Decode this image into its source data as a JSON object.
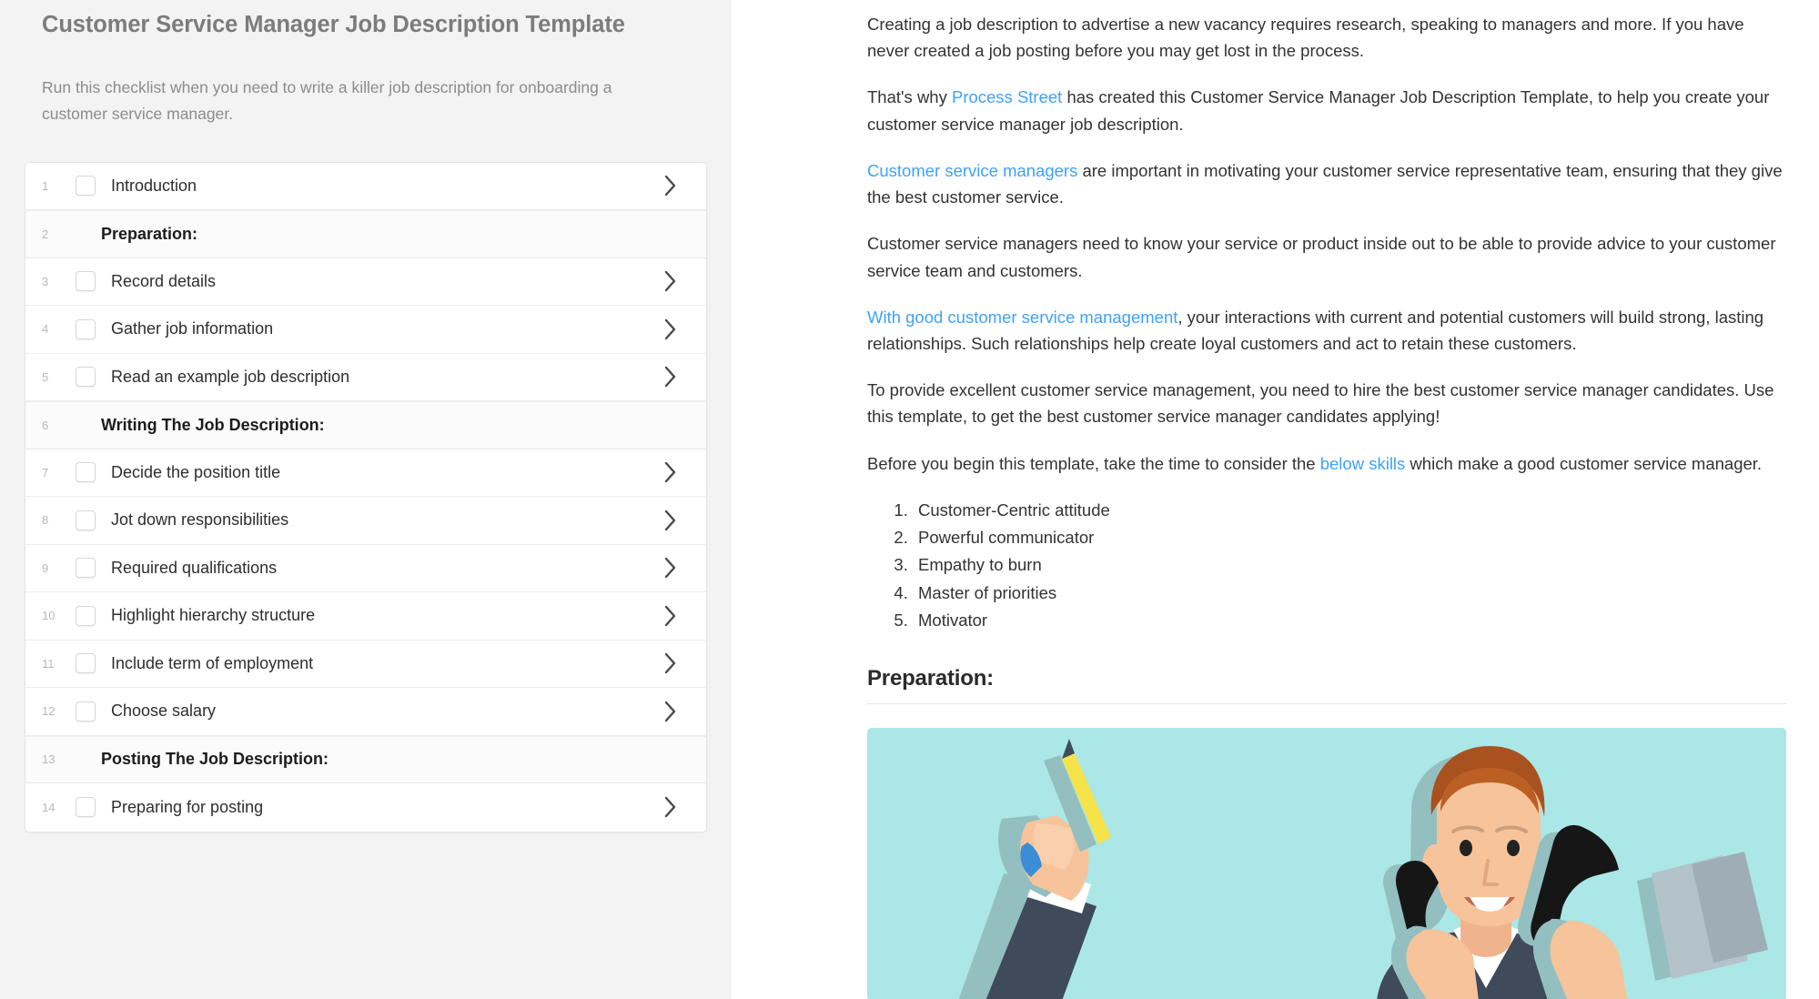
{
  "checklist": {
    "title": "Customer Service Manager Job Description Template",
    "description": "Run this checklist when you need to write a killer job description for onboarding a customer service manager.",
    "items": [
      {
        "num": "1",
        "label": "Introduction",
        "type": "task"
      },
      {
        "num": "2",
        "label": "Preparation:",
        "type": "heading"
      },
      {
        "num": "3",
        "label": "Record details",
        "type": "task"
      },
      {
        "num": "4",
        "label": "Gather job information",
        "type": "task"
      },
      {
        "num": "5",
        "label": "Read an example job description",
        "type": "task"
      },
      {
        "num": "6",
        "label": "Writing The Job Description:",
        "type": "heading"
      },
      {
        "num": "7",
        "label": "Decide the position title",
        "type": "task"
      },
      {
        "num": "8",
        "label": "Jot down responsibilities",
        "type": "task"
      },
      {
        "num": "9",
        "label": "Required qualifications",
        "type": "task"
      },
      {
        "num": "10",
        "label": "Highlight hierarchy structure",
        "type": "task"
      },
      {
        "num": "11",
        "label": "Include term of employment",
        "type": "task"
      },
      {
        "num": "12",
        "label": "Choose salary",
        "type": "task"
      },
      {
        "num": "13",
        "label": "Posting The Job Description:",
        "type": "heading"
      },
      {
        "num": "14",
        "label": "Preparing for posting",
        "type": "task"
      }
    ]
  },
  "document": {
    "paragraphs": {
      "p1": "Creating a job description to advertise a new vacancy requires research, speaking to managers and more. If you have never created a job posting before you may get lost in the process.",
      "p2_pre": "That's why ",
      "p2_link": "Process Street",
      "p2_post": " has created this Customer Service Manager Job Description Template, to help you create your customer service manager job description.",
      "p3_link": "Customer service managers",
      "p3_post": " are important in motivating your customer service representative team, ensuring that they give the best customer service.",
      "p4": "Customer service managers need to know your service or product inside out to be able to provide advice to your customer service team and customers.",
      "p5_link": "With good customer service management",
      "p5_post": ", your interactions with current and potential customers will build strong, lasting relationships. Such relationships help create loyal customers and act to retain these customers.",
      "p6": "To provide excellent customer service management, you need to hire the best customer service manager candidates. Use this template, to get the best customer service manager candidates applying!",
      "p7_pre": "Before you begin this template, take the time to consider the ",
      "p7_link": "below skills",
      "p7_post": " which make a good customer service manager."
    },
    "skills": [
      "Customer-Centric attitude",
      "Powerful communicator",
      "Empathy to burn",
      "Master of priorities",
      "Motivator"
    ],
    "section_heading": "Preparation:",
    "illustration_alt": "customer-service-manager-illustration"
  },
  "colors": {
    "link": "#3fa2f7",
    "panel_bg": "#f2f3f2",
    "illustration_bg": "#aae7e6",
    "title": "#7c7c7c"
  }
}
